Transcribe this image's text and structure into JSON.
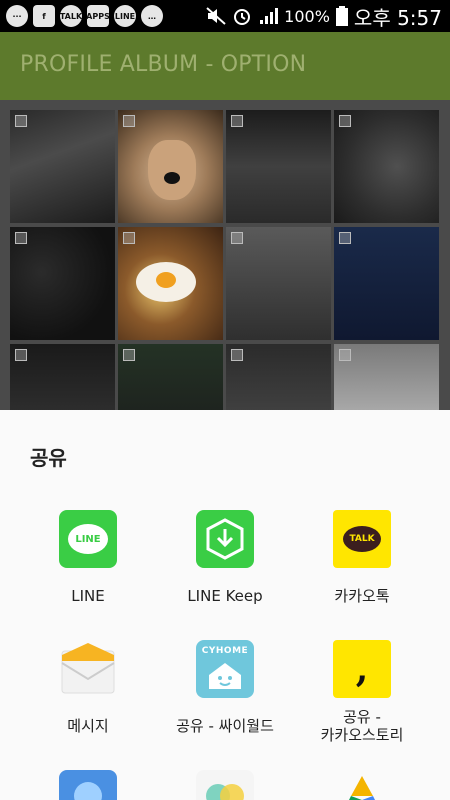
{
  "status_bar": {
    "notification_icons": [
      "chat-icon",
      "facebook-icon",
      "talk-icon",
      "apps-icon",
      "line-icon",
      "wechat-icon"
    ],
    "notification_labels": [
      "···",
      "f",
      "TALK",
      "APPS",
      "LINE",
      "…"
    ],
    "battery": "100%",
    "time": "오후 5:57"
  },
  "app_bar": {
    "title": "PROFILE ALBUM - OPTION"
  },
  "share_sheet": {
    "title": "공유",
    "apps": [
      {
        "label": "LINE",
        "icon": "line-icon",
        "icon_text": "LINE"
      },
      {
        "label": "LINE Keep",
        "icon": "line-keep-icon"
      },
      {
        "label": "카카오톡",
        "icon": "kakaotalk-icon",
        "icon_text": "TALK"
      },
      {
        "label": "메시지",
        "icon": "message-envelope-icon"
      },
      {
        "label": "공유 - 싸이월드",
        "icon": "cyworld-home-icon",
        "icon_text": "CYHOME"
      },
      {
        "label": "공유 -\n카카오스토리",
        "icon": "kakaostory-icon",
        "icon_text": ","
      }
    ],
    "partial_icons": [
      "cloud-icon",
      "photos-icon",
      "google-drive-icon"
    ]
  },
  "colors": {
    "app_bar": "#5d7a2c",
    "line_green": "#3acd45",
    "kakao_yellow": "#ffe600",
    "sheet_bg": "#fafafa"
  }
}
